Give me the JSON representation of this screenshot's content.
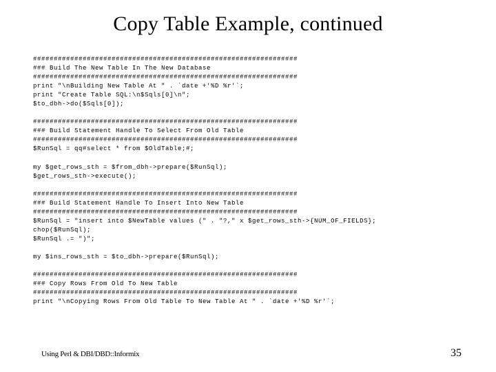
{
  "title": "Copy Table Example, continued",
  "code": "################################################################\n### Build The New Table In The New Database\n################################################################\nprint \"\\nBuilding New Table At \" . `date +'%D %r'`;\nprint \"Create Table SQL:\\n$Sqls[0]\\n\";\n$to_dbh->do($Sqls[0]);\n\n################################################################\n### Build Statement Handle To Select From Old Table\n################################################################\n$RunSql = qq#select * from $OldTable;#;\n\nmy $get_rows_sth = $from_dbh->prepare($RunSql);\n$get_rows_sth->execute();\n\n################################################################\n### Build Statement Handle To Insert Into New Table\n################################################################\n$RunSql = \"insert into $NewTable values (\" . \"?,\" x $get_rows_sth->{NUM_OF_FIELDS};\nchop($RunSql);\n$RunSql .= \")\";\n\nmy $ins_rows_sth = $to_dbh->prepare($RunSql);\n\n################################################################\n### Copy Rows From Old To New Table\n################################################################\nprint \"\\nCopying Rows From Old Table To New Table At \" . `date +'%D %r'`;",
  "footer": "Using Perl & DBI/DBD::Informix",
  "page_number": "35"
}
